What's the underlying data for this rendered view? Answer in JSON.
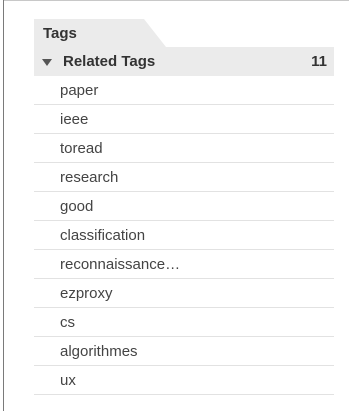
{
  "tags_panel": {
    "tab_label": "Tags",
    "related": {
      "label": "Related Tags",
      "count": "11",
      "expanded": true
    },
    "items": [
      {
        "label": "paper"
      },
      {
        "label": "ieee"
      },
      {
        "label": "toread"
      },
      {
        "label": "research"
      },
      {
        "label": "good"
      },
      {
        "label": "classification"
      },
      {
        "label": "reconnaissance…"
      },
      {
        "label": "ezproxy"
      },
      {
        "label": "cs"
      },
      {
        "label": "algorithmes"
      },
      {
        "label": "ux"
      }
    ]
  },
  "colors": {
    "tab_bg": "#ebebeb",
    "header_bg": "#ebebeb",
    "text": "#333333",
    "divider": "#e2e2e2"
  },
  "icons": {
    "expand_toggle": "triangle-down-icon"
  }
}
